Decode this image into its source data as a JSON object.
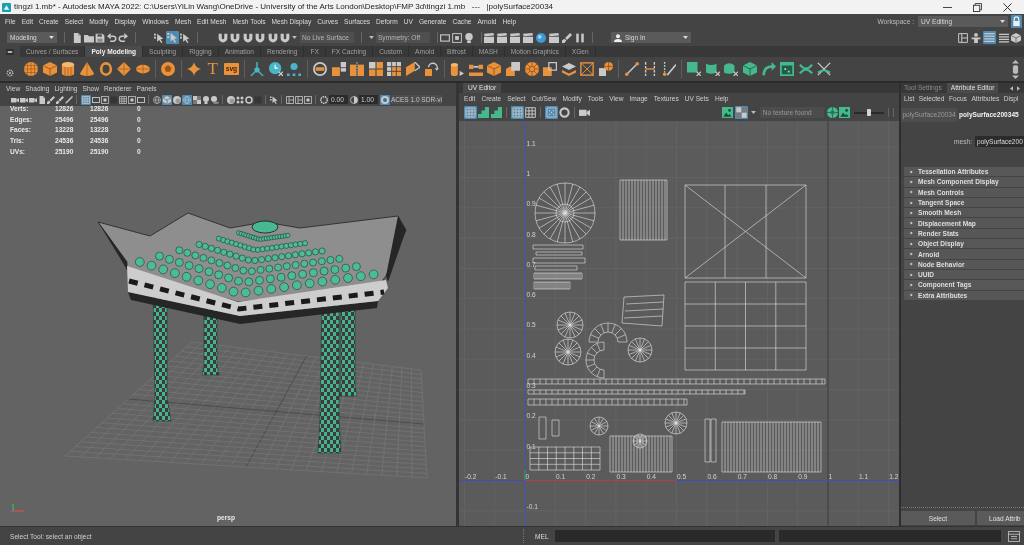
{
  "window": {
    "title": "tingzi 1.mb* - Autodesk MAYA 2022: C:\\Users\\YiLin Wang\\OneDrive - University of the Arts London\\Desktop\\FMP 3d\\tingzi 1.mb   ---   |polySurface20034"
  },
  "menu_bar": {
    "items": [
      "File",
      "Edit",
      "Create",
      "Select",
      "Modify",
      "Display",
      "Windows",
      "Mesh",
      "Edit Mesh",
      "Mesh Tools",
      "Mesh Display",
      "Curves",
      "Surfaces",
      "Deform",
      "UV",
      "Generate",
      "Cache",
      "Arnold",
      "Help"
    ],
    "workspace_label": "Workspace :",
    "workspace": "UV Editing",
    "workspace_locked": true
  },
  "status_line": {
    "menu_set": "Modeling",
    "file_tools": [
      {
        "kind": "page",
        "on": false
      },
      {
        "kind": "folder",
        "on": false
      },
      {
        "kind": "disk",
        "on": false
      },
      {
        "kind": "undo",
        "on": false
      },
      {
        "kind": "redo",
        "on": false
      }
    ],
    "select_modes": [
      {
        "kind": "cursor",
        "on": false
      },
      {
        "kind": "cursor",
        "on": true
      },
      {
        "kind": "cursor",
        "on": false
      }
    ],
    "snap_tools": [
      {
        "kind": "magnet",
        "on": false
      },
      {
        "kind": "magnet",
        "on": false
      },
      {
        "kind": "magnet",
        "on": false
      },
      {
        "kind": "magnet",
        "on": false
      },
      {
        "kind": "magnet",
        "on": false
      },
      {
        "kind": "magnet",
        "on": false
      }
    ],
    "live_surface": "No Live Surface",
    "symmetry": "Symmetry: Off",
    "history_tools": [
      {
        "kind": "frame",
        "on": false
      },
      {
        "kind": "framed-square",
        "on": false
      },
      {
        "kind": "bulb",
        "on": false
      }
    ],
    "render_tools": [
      {
        "kind": "clapper",
        "on": false
      },
      {
        "kind": "clapper",
        "on": false
      },
      {
        "kind": "clapper",
        "on": false
      },
      {
        "kind": "clapper",
        "on": false
      },
      {
        "kind": "sphere",
        "on": false
      },
      {
        "kind": "clapper",
        "on": false
      },
      {
        "kind": "brush",
        "on": false
      },
      {
        "kind": "pause",
        "on": false
      }
    ],
    "sign_in": "Sign In",
    "panel_tools": [
      {
        "kind": "panes",
        "on": false
      },
      {
        "kind": "person",
        "on": false
      },
      {
        "kind": "lines",
        "on": true
      },
      {
        "kind": "lines",
        "on": false
      },
      {
        "kind": "cube",
        "on": false
      }
    ]
  },
  "shelf": {
    "tabs": [
      {
        "label": "Curves / Surfaces",
        "selected": false
      },
      {
        "label": "Poly Modeling",
        "selected": true
      },
      {
        "label": "Sculpting",
        "selected": false
      },
      {
        "label": "Rigging",
        "selected": false
      },
      {
        "label": "Animation",
        "selected": false
      },
      {
        "label": "Rendering",
        "selected": false
      },
      {
        "label": "FX",
        "selected": false
      },
      {
        "label": "FX Caching",
        "selected": false
      },
      {
        "label": "Custom",
        "selected": false
      },
      {
        "label": "Arnold",
        "selected": false
      },
      {
        "label": "Bifrost",
        "selected": false
      },
      {
        "label": "MASH",
        "selected": false
      },
      {
        "label": "Motion Graphics",
        "selected": false
      },
      {
        "label": "XGen",
        "selected": false
      }
    ],
    "type_tool": "T",
    "svg_tool": "svg"
  },
  "viewport": {
    "menu": [
      "View",
      "Shading",
      "Lighting",
      "Show",
      "Renderer",
      "Panels"
    ],
    "toolbar": [
      [
        {
          "kind": "camera",
          "on": false
        },
        {
          "kind": "camera",
          "on": false
        },
        {
          "kind": "camera",
          "on": false
        },
        {
          "kind": "page",
          "on": false
        },
        {
          "kind": "brush",
          "on": false
        },
        {
          "kind": "brush",
          "on": false
        },
        {
          "kind": "pen",
          "on": false
        }
      ],
      [
        {
          "kind": "grid",
          "on": true
        },
        {
          "kind": "frame",
          "on": false
        },
        {
          "kind": "framed-square",
          "on": false
        },
        {
          "kind": "filled-square",
          "on": false
        },
        {
          "kind": "grid",
          "on": false
        },
        {
          "kind": "framed-square",
          "on": false
        },
        {
          "kind": "frame",
          "on": false
        }
      ],
      [
        {
          "kind": "wireframe-sphere",
          "on": false
        },
        {
          "kind": "cube",
          "on": true
        },
        {
          "kind": "shaded-sphere",
          "on": false
        },
        {
          "kind": "wireframe-sphere",
          "on": true
        },
        {
          "kind": "checker",
          "on": false
        },
        {
          "kind": "bulb",
          "on": false
        },
        {
          "kind": "shadow",
          "on": false
        }
      ],
      [
        {
          "kind": "shaded-sphere",
          "on": false
        },
        {
          "kind": "dots",
          "on": false
        },
        {
          "kind": "ring",
          "on": false
        },
        {
          "kind": "filled-square",
          "on": false
        }
      ],
      [
        {
          "kind": "cursor",
          "on": false
        }
      ],
      [
        {
          "kind": "panes",
          "on": false
        },
        {
          "kind": "panes",
          "on": false
        },
        {
          "kind": "framed-square",
          "on": false
        }
      ]
    ],
    "exposure": "0.00",
    "gamma": "1.00",
    "color_management": {
      "on": true,
      "view": "ACES 1.0 SDR-vi"
    },
    "hud": [
      {
        "label": "Verts:",
        "values": [
          "12826",
          "12826",
          "0"
        ]
      },
      {
        "label": "Edges:",
        "values": [
          "25496",
          "25496",
          "0"
        ]
      },
      {
        "label": "Faces:",
        "values": [
          "13228",
          "13228",
          "0"
        ]
      },
      {
        "label": "Tris:",
        "values": [
          "24536",
          "24536",
          "0"
        ]
      },
      {
        "label": "UVs:",
        "values": [
          "25190",
          "25190",
          "0"
        ]
      }
    ],
    "camera": "persp"
  },
  "uv_editor": {
    "tab": "UV Editor",
    "menu": [
      "Edit",
      "Create",
      "Select",
      "Cut/Sew",
      "Modify",
      "Tools",
      "View",
      "Image",
      "Textures",
      "UV Sets",
      "Help"
    ],
    "toolbar": [
      [
        {
          "kind": "grid",
          "on": true
        },
        {
          "kind": "stairs",
          "on": false
        },
        {
          "kind": "stairs",
          "on": false
        }
      ],
      [
        {
          "kind": "grid",
          "on": true
        },
        {
          "kind": "grid",
          "on": false
        }
      ],
      [
        {
          "kind": "dot-grid",
          "on": true
        },
        {
          "kind": "ring",
          "on": false
        }
      ],
      [
        {
          "kind": "camera",
          "on": false
        }
      ]
    ],
    "texture_tools": [
      {
        "kind": "image",
        "on": false
      },
      {
        "kind": "checker",
        "on": true
      }
    ],
    "texture": "No texture found",
    "display_tools": [
      {
        "kind": "wheel",
        "on": false
      },
      {
        "kind": "image",
        "on": false
      }
    ],
    "slider": {
      "level": 0.5
    },
    "u_labels_negative": [
      "-0.2",
      "-0.1"
    ],
    "u_labels": [
      "0",
      "0.1",
      "0.2",
      "0.3",
      "0.4",
      "0.5",
      "0.6",
      "0.7",
      "0.8",
      "0.9",
      "1",
      "1.1",
      "1.2"
    ],
    "v_labels": [
      "1.1",
      "1",
      "0.9",
      "0.8",
      "0.7",
      "0.6",
      "0.5",
      "0.4",
      "0.3",
      "0.2",
      "0.1"
    ],
    "v_labels_negative": [
      "-0.1"
    ]
  },
  "attribute_editor": {
    "tabs": [
      {
        "label": "Tool Settings",
        "selected": false
      },
      {
        "label": "Attribute Editor",
        "selected": true
      }
    ],
    "menu": [
      "List",
      "Selected",
      "Focus",
      "Attributes",
      "Displ"
    ],
    "nodes": [
      {
        "label": "polySurface20034",
        "selected": false
      },
      {
        "label": "polySurface200345",
        "selected": true
      }
    ],
    "mesh_label": "mesh:",
    "mesh": "polySurface200",
    "sections": [
      {
        "label": "Tessellation Attributes",
        "expanded": false
      },
      {
        "label": "Mesh Component Display",
        "expanded": false
      },
      {
        "label": "Mesh Controls",
        "expanded": false
      },
      {
        "label": "Tangent Space",
        "expanded": false
      },
      {
        "label": "Smooth Mesh",
        "expanded": false
      },
      {
        "label": "Displacement Map",
        "expanded": false
      },
      {
        "label": "Render Stats",
        "expanded": false
      },
      {
        "label": "Object Display",
        "expanded": false
      },
      {
        "label": "Arnold",
        "expanded": false
      },
      {
        "label": "Node Behavior",
        "expanded": false
      },
      {
        "label": "UUID",
        "expanded": false
      },
      {
        "label": "Component Tags",
        "expanded": false
      },
      {
        "label": "Extra Attributes",
        "expanded": false
      }
    ],
    "buttons": [
      "Select",
      "Load Attrib"
    ]
  },
  "command_line": {
    "help": "Select Tool: select an object",
    "language": "MEL"
  }
}
